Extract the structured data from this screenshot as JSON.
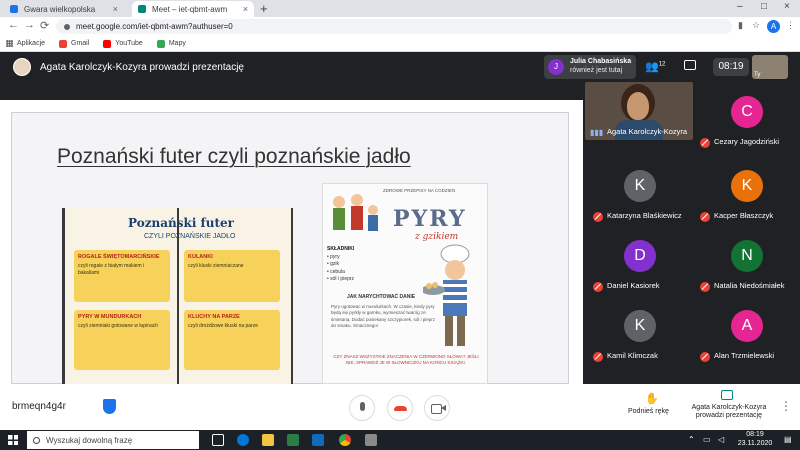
{
  "browser": {
    "tabs": [
      {
        "label": "Gwara wielkopolska"
      },
      {
        "label": "Meet – iet-qbmt-awm"
      }
    ],
    "new_tab": "+",
    "url": "meet.google.com/iet-qbmt-awm?authuser=0",
    "profile_initial": "A",
    "bookmarks": [
      "Aplikacje",
      "Gmail",
      "YouTube",
      "Mapy"
    ]
  },
  "meet": {
    "presenter_banner": "Agata Karolczyk-Kozyra prowadzi prezentację",
    "join_notice": {
      "initial": "J",
      "name": "Julia Chabasińska",
      "text": "również jest tutaj"
    },
    "participant_count": "12",
    "time": "08:19",
    "self_label": "Ty",
    "meeting_code": "brmeqn4g4r",
    "raise_hand_label": "Podnieś rękę",
    "presenting_label": "Agata Karolczyk-Kozyra prowadzi prezentację",
    "participants": [
      {
        "name": "Agata Karolczyk-Kozyra",
        "initial": "",
        "color": "#5a4e44",
        "video": true
      },
      {
        "name": "Cezary Jagodziński",
        "initial": "C",
        "color": "#e52592"
      },
      {
        "name": "Katarzyna Blaśkiewicz",
        "initial": "K",
        "color": "#5f6368"
      },
      {
        "name": "Kacper Błaszczyk",
        "initial": "K",
        "color": "#e8710a"
      },
      {
        "name": "Daniel Kasiorek",
        "initial": "D",
        "color": "#8430ce"
      },
      {
        "name": "Natalia Niedośmiałek",
        "initial": "N",
        "color": "#137333"
      },
      {
        "name": "Kamil Klimczak",
        "initial": "K",
        "color": "#5f6368"
      },
      {
        "name": "Alan Trzmielewski",
        "initial": "A",
        "color": "#e52592"
      }
    ]
  },
  "slide": {
    "title": "Poznański futer czyli poznańskie jadło",
    "book_title": "Poznański futer",
    "book_subtitle": "CZYLI POZNAŃSKIE JADŁO",
    "cards": [
      {
        "head": "ROGALE ŚWIĘTOMARCIŃSKIE",
        "text": "czyli rogale z białym makiem i bakaliami"
      },
      {
        "head": "KULANKI",
        "text": "czyli kluski ziemniaczane"
      },
      {
        "head": "PYRY W MUNDURKACH",
        "text": "czyli ziemniaki gotowane w łupinach"
      },
      {
        "head": "KLUCHY NA PARZE",
        "text": "czyli drożdżowe kluski na parze"
      }
    ],
    "poster_head": "ZDROWE PRZEPISY NA CODZIEŃ",
    "poster_title": "PYRY",
    "poster_sub": "z gzikiem",
    "ingredients_label": "SKŁADNIKI",
    "ingredients": [
      "pyry",
      "gzik",
      "cebula",
      "sól i pieprz"
    ],
    "howto_label": "JAK NARYCHTOWAĆ DANIE",
    "howto_text": "Pyry ugotowac w mundurkach. W czasie, kiedy pyry będą się pyrkły w garnku, wymieszać twaróg ze śmietaną. Dodać posiekany szczypiorek, sól i pieprz do smaku. Smacznego!",
    "footnote": "CZY ZNASZ WSZYSTKIE ZNACZENIA W CZERWONO SŁOWA? JEŚLI NIE, SPRAWDŹ JE W SŁOWNICZKU NA KOŃCU KSIĄŻKI."
  },
  "taskbar": {
    "search_placeholder": "Wyszukaj dowolną frazę",
    "time": "08:19",
    "date": "23.11.2020"
  }
}
